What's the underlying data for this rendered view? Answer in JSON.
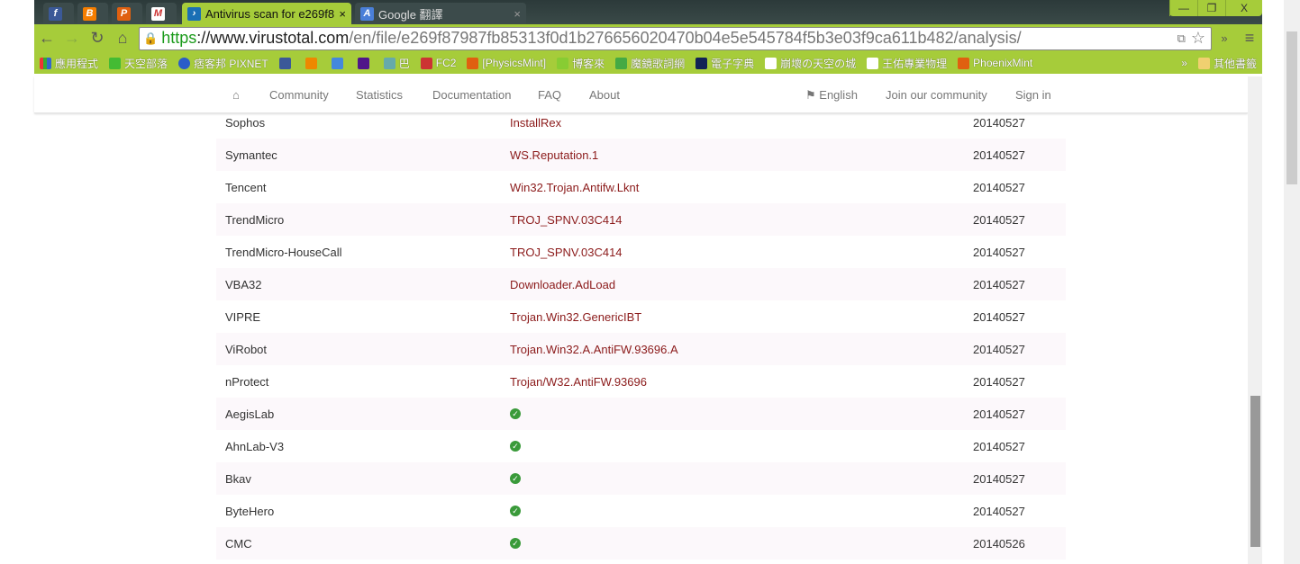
{
  "browser": {
    "tabs": [
      {
        "label": "",
        "icon": "facebook-icon"
      },
      {
        "label": "",
        "icon": "blogger-icon"
      },
      {
        "label": "",
        "icon": "p-icon"
      },
      {
        "label": "",
        "icon": "gmail-icon"
      },
      {
        "label": "Antivirus scan for e269f8",
        "icon": "virustotal-icon",
        "active": true
      },
      {
        "label": "Google 翻譯",
        "icon": "translate-icon"
      }
    ],
    "url": {
      "scheme": "https",
      "domain": "://www.virustotal.com",
      "path": "/en/file/e269f87987fb85313f0d1b276656020470b04e5e545784f5b3e03f9ca611b482/analysis/"
    },
    "bookmarks": [
      "應用程式",
      "天空部落",
      "痞客邦 PIXNET",
      "",
      "",
      "",
      "",
      "巴",
      "FC2",
      "[PhysicsMint]",
      "博客來",
      "魔鏡歌詞網",
      "電子字典",
      "崩壞の天空の城",
      "王佑專業物理",
      "PhoenixMint"
    ],
    "other_bookmarks": "其他書籤"
  },
  "nav": {
    "items": [
      "Community",
      "Statistics",
      "Documentation",
      "FAQ",
      "About"
    ],
    "language": "English",
    "join": "Join our community",
    "signin": "Sign in"
  },
  "results": [
    {
      "engine": "Sophos",
      "result": "InstallRex",
      "date": "20140527"
    },
    {
      "engine": "Symantec",
      "result": "WS.Reputation.1",
      "date": "20140527"
    },
    {
      "engine": "Tencent",
      "result": "Win32.Trojan.Antifw.Lknt",
      "date": "20140527"
    },
    {
      "engine": "TrendMicro",
      "result": "TROJ_SPNV.03C414",
      "date": "20140527"
    },
    {
      "engine": "TrendMicro-HouseCall",
      "result": "TROJ_SPNV.03C414",
      "date": "20140527"
    },
    {
      "engine": "VBA32",
      "result": "Downloader.AdLoad",
      "date": "20140527"
    },
    {
      "engine": "VIPRE",
      "result": "Trojan.Win32.GenericIBT",
      "date": "20140527"
    },
    {
      "engine": "ViRobot",
      "result": "Trojan.Win32.A.AntiFW.93696.A",
      "date": "20140527"
    },
    {
      "engine": "nProtect",
      "result": "Trojan/W32.AntiFW.93696",
      "date": "20140527"
    },
    {
      "engine": "AegisLab",
      "result": null,
      "date": "20140527"
    },
    {
      "engine": "AhnLab-V3",
      "result": null,
      "date": "20140527"
    },
    {
      "engine": "Bkav",
      "result": null,
      "date": "20140527"
    },
    {
      "engine": "ByteHero",
      "result": null,
      "date": "20140527"
    },
    {
      "engine": "CMC",
      "result": null,
      "date": "20140526"
    }
  ]
}
